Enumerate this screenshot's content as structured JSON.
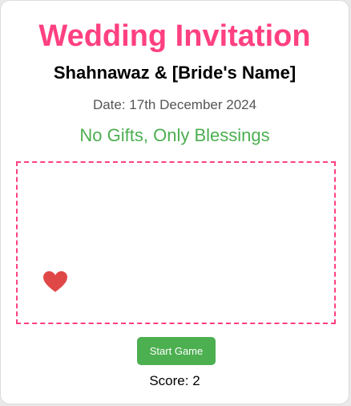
{
  "invitation": {
    "title": "Wedding Invitation",
    "names": "Shahnawaz & [Bride's Name]",
    "date": "Date: 17th December 2024",
    "gifts_note": "No Gifts, Only Blessings"
  },
  "game": {
    "target_icon": "heart-icon",
    "start_label": "Start Game",
    "score_text": "Score: 2"
  },
  "colors": {
    "title": "#ff4081",
    "gifts_note": "#4caf50",
    "button": "#4caf50",
    "heart": "#e04848",
    "game_border": "#ff4081"
  }
}
